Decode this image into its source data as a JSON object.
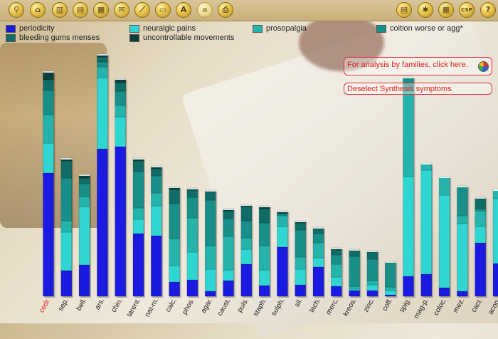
{
  "toolbar": {
    "icons": [
      {
        "name": "search-icon",
        "glyph": "⚲"
      },
      {
        "name": "home-icon",
        "glyph": "⌂"
      },
      {
        "name": "repertory-icon",
        "glyph": "▥"
      },
      {
        "name": "document-icon",
        "glyph": "▤"
      },
      {
        "name": "book-icon",
        "glyph": "▦"
      },
      {
        "name": "envelope-icon",
        "glyph": "✉"
      },
      {
        "name": "graph-icon",
        "glyph": "⟋"
      },
      {
        "name": "folder-icon",
        "glyph": "▭"
      },
      {
        "name": "font-a-icon",
        "glyph": "A"
      },
      {
        "name": "font-a-small-icon",
        "glyph": "a"
      },
      {
        "name": "print-icon",
        "glyph": "⎙"
      }
    ],
    "right_icons": [
      {
        "name": "notes-icon",
        "glyph": "▤"
      },
      {
        "name": "tools-icon",
        "glyph": "✱"
      },
      {
        "name": "calendar-icon",
        "glyph": "▦"
      },
      {
        "name": "csp-icon",
        "glyph": "CSP"
      },
      {
        "name": "help-icon",
        "glyph": "?"
      }
    ]
  },
  "links": {
    "families": "For analysis by families, click here.",
    "deselect": "Deselect Synthesis symptoms"
  },
  "colors": {
    "periodicity": "#1a1ae0",
    "neuralgic_pains": "#2fd6d2",
    "prosopalgia": "#24b4ac",
    "coition_worse_or_agg": "#188f88",
    "bleeding_gums_menses": "#0f6c66",
    "uncontrollable_movements": "#0a3f3b",
    "highlight_label": "#e02020"
  },
  "chart_data": {
    "type": "bar",
    "stacked": true,
    "highlighted_category": "cedr.",
    "categories": [
      "cedr.",
      "sep.",
      "bell.",
      "ars.",
      "chin.",
      "tarent.",
      "nat-m.",
      "calc.",
      "phos.",
      "agar.",
      "caust.",
      "puls.",
      "staph.",
      "sulph.",
      "sil.",
      "lach.",
      "merc.",
      "kreos.",
      "zinc.",
      "coff.",
      "spig.",
      "mag-p.",
      "coloc.",
      "mez.",
      "cact.",
      "acon."
    ],
    "series": [
      {
        "name": "periodicity",
        "values": [
          173,
          36,
          44,
          207,
          210,
          88,
          85,
          20,
          23,
          7,
          22,
          45,
          15,
          69,
          16,
          41,
          14,
          8,
          8,
          2,
          28,
          31,
          12,
          7,
          75,
          46
        ]
      },
      {
        "name": "neuralgic pains",
        "values": [
          42,
          54,
          82,
          100,
          42,
          20,
          42,
          23,
          39,
          31,
          15,
          21,
          22,
          29,
          22,
          13,
          13,
          2,
          8,
          6,
          140,
          146,
          130,
          95,
          23,
          91
        ]
      },
      {
        "name": "prosopalgia",
        "values": [
          40,
          16,
          14,
          15,
          16,
          16,
          18,
          38,
          48,
          33,
          47,
          16,
          34,
          15,
          17,
          21,
          18,
          4,
          6,
          5,
          120,
          10,
          26,
          11,
          22,
          13
        ]
      },
      {
        "name": "coition worse or agg*",
        "values": [
          34,
          60,
          18,
          7,
          20,
          51,
          24,
          49,
          29,
          64,
          25,
          24,
          32,
          3,
          38,
          13,
          13,
          42,
          30,
          34,
          20,
          0,
          0,
          42,
          3,
          0
        ]
      },
      {
        "name": "bleeding gums menses",
        "values": [
          15,
          24,
          8,
          7,
          12,
          15,
          10,
          20,
          10,
          12,
          11,
          20,
          20,
          0,
          10,
          7,
          7,
          8,
          10,
          0,
          0,
          0,
          0,
          0,
          14,
          0
        ]
      },
      {
        "name": "uncontrollable movements",
        "values": [
          12,
          4,
          5,
          4,
          6,
          4,
          4,
          4,
          3,
          2,
          3,
          3,
          4,
          4,
          3,
          2,
          3,
          2,
          2,
          2,
          0,
          0,
          0,
          0,
          2,
          0
        ]
      }
    ]
  }
}
